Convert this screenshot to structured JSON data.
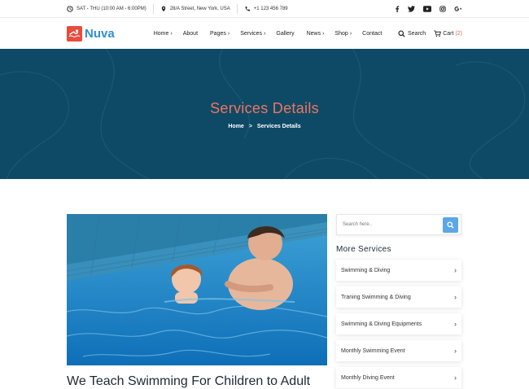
{
  "topbar": {
    "hours": "SAT - THU (10:00 AM - 6:00PM)",
    "address": "28/A Street, New York, USA",
    "phone": "+1 123 456 789",
    "social": [
      "f",
      "t",
      "yt",
      "ig",
      "G+"
    ]
  },
  "nav": {
    "logo_text": "Nuva",
    "menu": [
      {
        "label": "Home",
        "chevron": "›"
      },
      {
        "label": "About",
        "chevron": ""
      },
      {
        "label": "Pages",
        "chevron": "›"
      },
      {
        "label": "Services",
        "chevron": "›"
      },
      {
        "label": "Gallery",
        "chevron": ""
      },
      {
        "label": "News",
        "chevron": "›"
      },
      {
        "label": "Shop",
        "chevron": "›"
      },
      {
        "label": "Contact",
        "chevron": ""
      }
    ],
    "search_label": "Search",
    "cart_label": "Cart",
    "cart_count": "(2)"
  },
  "hero": {
    "title": "Services Details",
    "crumb_home": "Home",
    "crumb_sep": ">",
    "crumb_current": "Services Details"
  },
  "main": {
    "heading": "We Teach Swimming For Children to Adult"
  },
  "sidebar": {
    "search_placeholder": "Search here..",
    "more_title": "More Services",
    "services": [
      "Swimming & Diving",
      "Traning Swimming & Diving",
      "Swimming & Diving Equipments",
      "Monthly Swimming Event",
      "Monthly Diving Event"
    ]
  },
  "colors": {
    "accent": "#ef7560",
    "hero_bg": "#0e4a66",
    "brand_blue": "#2f8fd8",
    "search_btn": "#5ca7e8"
  }
}
